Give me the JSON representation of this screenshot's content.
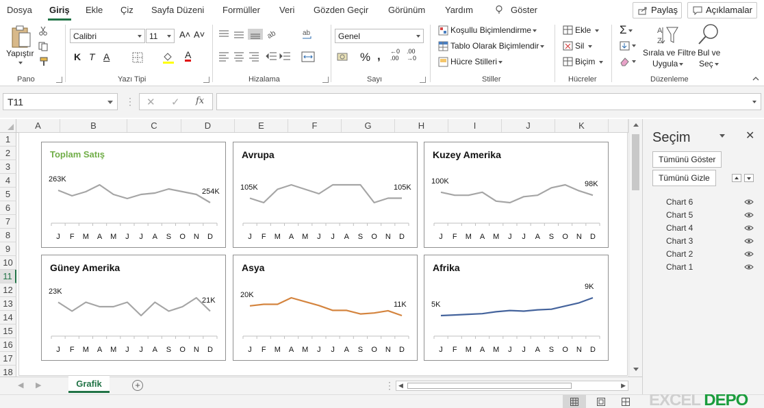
{
  "menu": {
    "tabs": [
      "Dosya",
      "Giriş",
      "Ekle",
      "Çiz",
      "Sayfa Düzeni",
      "Formüller",
      "Veri",
      "Gözden Geçir",
      "Görünüm",
      "Yardım"
    ],
    "active_tab": "Giriş",
    "search_label": "Göster",
    "share_label": "Paylaş",
    "comments_label": "Açıklamalar"
  },
  "ribbon": {
    "pano": {
      "label": "Pano",
      "paste": "Yapıştır"
    },
    "font": {
      "label": "Yazı Tipi",
      "family": "Calibri",
      "size": "11",
      "bold": "K",
      "italic": "T",
      "underline": "A"
    },
    "align": {
      "label": "Hizalama"
    },
    "number": {
      "label": "Sayı",
      "format": "Genel"
    },
    "styles": {
      "label": "Stiller",
      "conditional": "Koşullu Biçimlendirme",
      "table": "Tablo Olarak Biçimlendir",
      "cell": "Hücre Stilleri"
    },
    "cells": {
      "label": "Hücreler",
      "insert": "Ekle",
      "delete": "Sil",
      "format": "Biçim"
    },
    "editing": {
      "label": "Düzenleme",
      "sort1": "Sırala ve Filtre",
      "sort2": "Uygula",
      "find1": "Bul ve",
      "find2": "Seç"
    }
  },
  "formula_bar": {
    "name_box": "T11",
    "formula": ""
  },
  "grid": {
    "columns": [
      "A",
      "B",
      "C",
      "D",
      "E",
      "F",
      "G",
      "H",
      "I",
      "J",
      "K"
    ],
    "rows": [
      "1",
      "2",
      "3",
      "4",
      "5",
      "6",
      "7",
      "8",
      "9",
      "10",
      "11",
      "12",
      "13",
      "14",
      "15",
      "16",
      "17",
      "18"
    ],
    "active_row": "11"
  },
  "sheet_tabs": {
    "active": "Grafik"
  },
  "selection_pane": {
    "title": "Seçim",
    "show_all": "Tümünü Göster",
    "hide_all": "Tümünü Gizle",
    "items": [
      "Chart 6",
      "Chart 5",
      "Chart 4",
      "Chart 3",
      "Chart 2",
      "Chart 1"
    ]
  },
  "watermark": "EXCEL DEPO",
  "colors": {
    "accent": "#217346",
    "gray_line": "#a5a5a5",
    "orange_line": "#d4843e",
    "blue_line": "#44639c",
    "title_green": "#70ad47"
  },
  "chart_data": [
    {
      "type": "line",
      "title": "Toplam Satış",
      "title_color": "#70ad47",
      "color": "#a5a5a5",
      "categories": [
        "J",
        "F",
        "M",
        "A",
        "M",
        "J",
        "J",
        "A",
        "S",
        "O",
        "N",
        "D"
      ],
      "values": [
        263,
        259,
        262,
        267,
        260,
        257,
        260,
        261,
        264,
        262,
        260,
        254
      ],
      "first_label": "263K",
      "last_label": "254K"
    },
    {
      "type": "line",
      "title": "Avrupa",
      "color": "#a5a5a5",
      "categories": [
        "J",
        "F",
        "M",
        "A",
        "M",
        "J",
        "J",
        "A",
        "S",
        "O",
        "N",
        "D"
      ],
      "values": [
        105,
        104,
        107,
        108,
        107,
        106,
        108,
        108,
        108,
        104,
        105,
        105
      ],
      "first_label": "105K",
      "last_label": "105K"
    },
    {
      "type": "line",
      "title": "Kuzey Amerika",
      "color": "#a5a5a5",
      "categories": [
        "J",
        "F",
        "M",
        "A",
        "M",
        "J",
        "J",
        "A",
        "S",
        "O",
        "N",
        "D"
      ],
      "values": [
        100,
        98,
        98,
        100,
        94,
        93,
        97,
        98,
        103,
        105,
        101,
        98
      ],
      "first_label": "100K",
      "last_label": "98K"
    },
    {
      "type": "line",
      "title": "Güney Amerika",
      "color": "#a5a5a5",
      "categories": [
        "J",
        "F",
        "M",
        "A",
        "M",
        "J",
        "J",
        "A",
        "S",
        "O",
        "N",
        "D"
      ],
      "values": [
        23,
        21,
        23,
        22,
        22,
        23,
        20,
        23,
        21,
        22,
        24,
        21
      ],
      "first_label": "23K",
      "last_label": "21K"
    },
    {
      "type": "line",
      "title": "Asya",
      "color": "#d4843e",
      "categories": [
        "J",
        "F",
        "M",
        "A",
        "M",
        "J",
        "J",
        "A",
        "S",
        "O",
        "N",
        "D"
      ],
      "values": [
        18.5,
        19,
        19,
        21,
        19.8,
        18.6,
        17.1,
        17.1,
        16,
        16.3,
        17,
        15.5
      ],
      "first_label": "20K",
      "last_label": "11K"
    },
    {
      "type": "line",
      "title": "Afrika",
      "color": "#44639c",
      "categories": [
        "J",
        "F",
        "M",
        "A",
        "M",
        "J",
        "J",
        "A",
        "S",
        "O",
        "N",
        "D"
      ],
      "values": [
        5.6,
        5.7,
        5.8,
        5.9,
        6.2,
        6.4,
        6.3,
        6.5,
        6.6,
        7.1,
        7.6,
        8.4
      ],
      "first_label": "5K",
      "last_label": "9K"
    }
  ]
}
